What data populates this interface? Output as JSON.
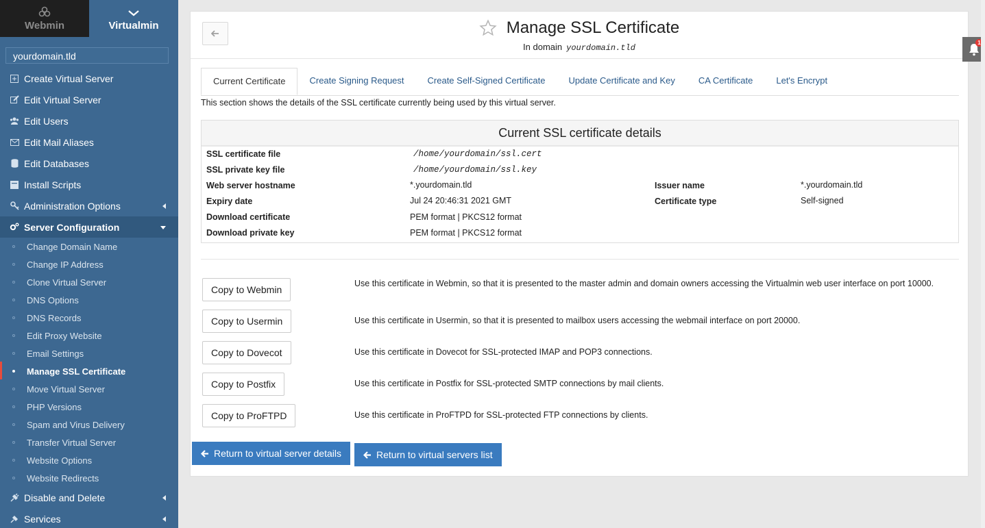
{
  "sidebar": {
    "switch": {
      "webmin": "Webmin",
      "virtualmin": "Virtualmin"
    },
    "domain": "yourdomain.tld",
    "items": [
      {
        "label": "Create Virtual Server",
        "icon": "plus-square-icon"
      },
      {
        "label": "Edit Virtual Server",
        "icon": "edit-icon"
      },
      {
        "label": "Edit Users",
        "icon": "users-icon"
      },
      {
        "label": "Edit Mail Aliases",
        "icon": "envelope-icon"
      },
      {
        "label": "Edit Databases",
        "icon": "database-icon"
      },
      {
        "label": "Install Scripts",
        "icon": "script-icon"
      },
      {
        "label": "Administration Options",
        "icon": "key-icon"
      },
      {
        "label": "Server Configuration",
        "icon": "cogs-icon"
      }
    ],
    "submenu": [
      "Change Domain Name",
      "Change IP Address",
      "Clone Virtual Server",
      "DNS Options",
      "DNS Records",
      "Edit Proxy Website",
      "Email Settings",
      "Manage SSL Certificate",
      "Move Virtual Server",
      "PHP Versions",
      "Spam and Virus Delivery",
      "Transfer Virtual Server",
      "Website Options",
      "Website Redirects"
    ],
    "bottom_items": [
      {
        "label": "Disable and Delete",
        "icon": "plug-icon"
      },
      {
        "label": "Services",
        "icon": "services-icon"
      }
    ]
  },
  "header": {
    "title": "Manage SSL Certificate",
    "subtitle_prefix": "In domain",
    "subtitle_domain": "yourdomain.tld"
  },
  "tabs": [
    "Current Certificate",
    "Create Signing Request",
    "Create Self-Signed Certificate",
    "Update Certificate and Key",
    "CA Certificate",
    "Let's Encrypt"
  ],
  "description": "This section shows the details of the SSL certificate currently being used by this virtual server.",
  "details": {
    "heading": "Current SSL certificate details",
    "cert_file_label": "SSL certificate file",
    "cert_file": "/home/yourdomain/ssl.cert",
    "key_file_label": "SSL private key file",
    "key_file": "/home/yourdomain/ssl.key",
    "hostname_label": "Web server hostname",
    "hostname": "*.yourdomain.tld",
    "issuer_label": "Issuer name",
    "issuer": "*.yourdomain.tld",
    "expiry_label": "Expiry date",
    "expiry": "Jul 24 20:46:31 2021 GMT",
    "type_label": "Certificate type",
    "type": "Self-signed",
    "dl_cert_label": "Download certificate",
    "dl_cert": "PEM format | PKCS12 format",
    "dl_key_label": "Download private key",
    "dl_key": "PEM format | PKCS12 format"
  },
  "copy_actions": [
    {
      "button": "Copy to Webmin",
      "text": "Use this certificate in Webmin, so that it is presented to the master admin and domain owners accessing the Virtualmin web user interface on port 10000."
    },
    {
      "button": "Copy to Usermin",
      "text": "Use this certificate in Usermin, so that it is presented to mailbox users accessing the webmail interface on port 20000."
    },
    {
      "button": "Copy to Dovecot",
      "text": "Use this certificate in Dovecot for SSL-protected IMAP and POP3 connections."
    },
    {
      "button": "Copy to Postfix",
      "text": "Use this certificate in Postfix for SSL-protected SMTP connections by mail clients."
    },
    {
      "button": "Copy to ProFTPD",
      "text": "Use this certificate in ProFTPD for SSL-protected FTP connections by clients."
    }
  ],
  "return_buttons": {
    "details": "Return to virtual server details",
    "list": "Return to virtual servers list"
  },
  "notifications": {
    "count": "1"
  }
}
